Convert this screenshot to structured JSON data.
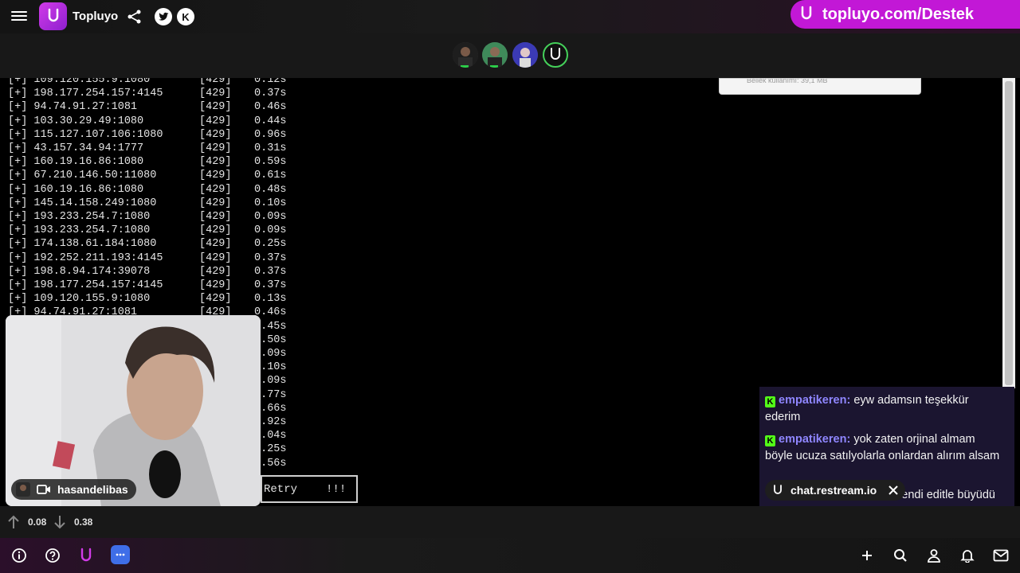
{
  "header": {
    "app_title": "Topluyo",
    "brand_link": "topluyo.com/Destek",
    "icons": [
      "menu-icon",
      "topluyo-logo-icon",
      "share-icon",
      "twitter-icon",
      "kick-icon"
    ]
  },
  "participants": [
    "participant-1",
    "participant-2",
    "participant-3",
    "topluyo-bot"
  ],
  "terminal": {
    "lines": [
      {
        "ip": "[+] 109.120.155.9:1080",
        "code": "[429]",
        "time": "0.12s"
      },
      {
        "ip": "[+] 198.177.254.157:4145",
        "code": "[429]",
        "time": "0.37s"
      },
      {
        "ip": "[+] 94.74.91.27:1081",
        "code": "[429]",
        "time": "0.46s"
      },
      {
        "ip": "[+] 103.30.29.49:1080",
        "code": "[429]",
        "time": "0.44s"
      },
      {
        "ip": "[+] 115.127.107.106:1080",
        "code": "[429]",
        "time": "0.96s"
      },
      {
        "ip": "[+] 43.157.34.94:1777",
        "code": "[429]",
        "time": "0.31s"
      },
      {
        "ip": "[+] 160.19.16.86:1080",
        "code": "[429]",
        "time": "0.59s"
      },
      {
        "ip": "[+] 67.210.146.50:11080",
        "code": "[429]",
        "time": "0.61s"
      },
      {
        "ip": "[+] 160.19.16.86:1080",
        "code": "[429]",
        "time": "0.48s"
      },
      {
        "ip": "[+] 145.14.158.249:1080",
        "code": "[429]",
        "time": "0.10s"
      },
      {
        "ip": "[+] 193.233.254.7:1080",
        "code": "[429]",
        "time": "0.09s"
      },
      {
        "ip": "[+] 193.233.254.7:1080",
        "code": "[429]",
        "time": "0.09s"
      },
      {
        "ip": "[+] 174.138.61.184:1080",
        "code": "[429]",
        "time": "0.25s"
      },
      {
        "ip": "[+] 192.252.211.193:4145",
        "code": "[429]",
        "time": "0.37s"
      },
      {
        "ip": "[+] 198.8.94.174:39078",
        "code": "[429]",
        "time": "0.37s"
      },
      {
        "ip": "[+] 198.177.254.157:4145",
        "code": "[429]",
        "time": "0.37s"
      },
      {
        "ip": "[+] 109.120.155.9:1080",
        "code": "[429]",
        "time": "0.13s"
      },
      {
        "ip": "[+] 94.74.91.27:1081",
        "code": "[429]",
        "time": "0.46s"
      },
      {
        "ip": "",
        "code": "",
        "time": "0.45s"
      },
      {
        "ip": "",
        "code": "",
        "time": "0.50s"
      },
      {
        "ip": "",
        "code": "",
        "time": "0.09s"
      },
      {
        "ip": "",
        "code": "",
        "time": "0.10s"
      },
      {
        "ip": "",
        "code": "",
        "time": "0.09s"
      },
      {
        "ip": "",
        "code": "",
        "time": "0.77s"
      },
      {
        "ip": "",
        "code": "",
        "time": "0.66s"
      },
      {
        "ip": "",
        "code": "",
        "time": "0.92s"
      },
      {
        "ip": "",
        "code": "",
        "time": "0.04s"
      },
      {
        "ip": "",
        "code": "",
        "time": "0.25s"
      },
      {
        "ip": "",
        "code": "",
        "time": "0.56s"
      }
    ],
    "retry_label": "Retry",
    "retry_mark": "!!!",
    "popup_text": "Bellek kullanımı: 39,1 MB"
  },
  "webcam": {
    "streamer_name": "hasandelibas"
  },
  "chat": {
    "messages": [
      {
        "user": "empatikeren",
        "sep": ":",
        "text": "eyw adamsın teşekkür ederim"
      },
      {
        "user": "empatikeren",
        "sep": ":",
        "text": "yok zaten orjinal almam böyle ucuza satılyolarla onlardan alırım alsam"
      },
      {
        "user": "",
        "sep": "",
        "text": "kendi editle büyüdü"
      }
    ],
    "source_label": "chat.restream.io"
  },
  "stats": {
    "upload": "0.08",
    "download": "0.38"
  },
  "toolbar": {
    "left_icons": [
      "info-icon",
      "help-icon",
      "topluyo-icon",
      "chat-icon"
    ],
    "right_icons": [
      "plus-icon",
      "search-icon",
      "user-icon",
      "bell-icon",
      "mail-icon"
    ]
  },
  "colors": {
    "brand": "#c218d6",
    "kick_green": "#53fc18",
    "chat_user": "#8f86ff"
  }
}
